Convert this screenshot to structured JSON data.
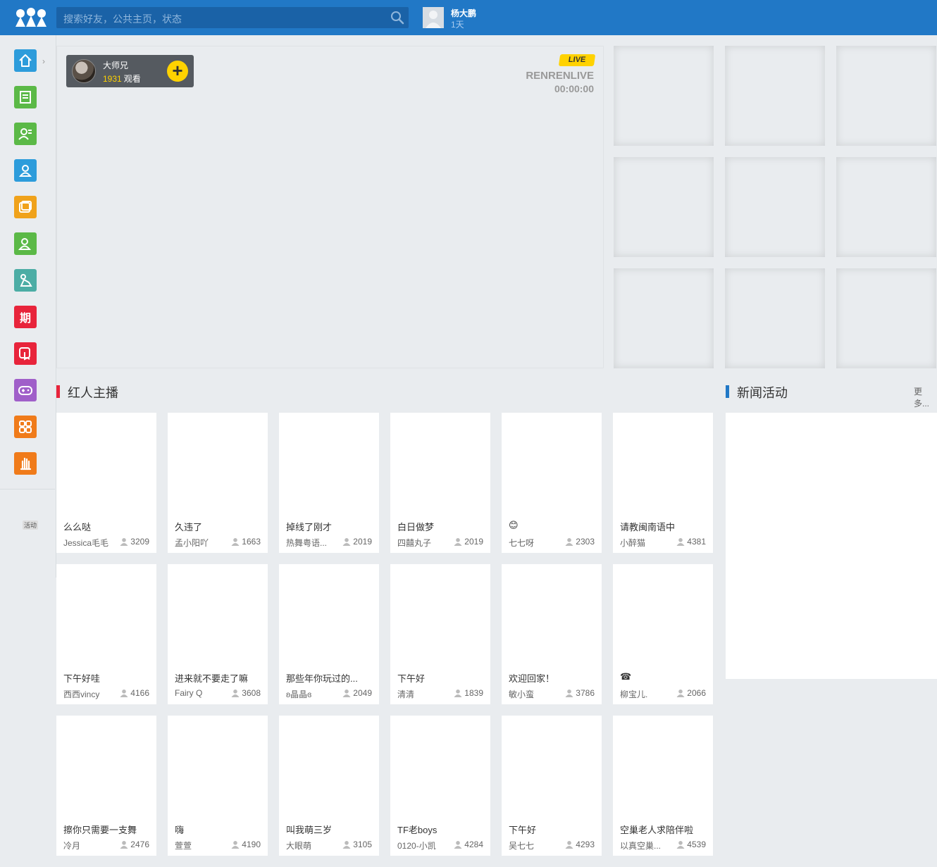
{
  "header": {
    "search_placeholder": "搜索好友，公共主页，状态",
    "user_name": "杨大鹏",
    "user_sub": "1天"
  },
  "sidebar": {
    "items": [
      {
        "icon": "home-icon",
        "color": "#2d9cdb"
      },
      {
        "icon": "notes-icon",
        "color": "#5bb947"
      },
      {
        "icon": "contacts-icon",
        "color": "#5bb947"
      },
      {
        "icon": "profile-icon",
        "color": "#2d9cdb"
      },
      {
        "icon": "photo-icon",
        "color": "#f0a21b"
      },
      {
        "icon": "friends-icon",
        "color": "#5bb947"
      },
      {
        "icon": "gift-icon",
        "color": "#4cada5"
      },
      {
        "icon": "issue-icon",
        "label": "期",
        "color": "#e8243b"
      },
      {
        "icon": "touch-icon",
        "color": "#e8243b"
      },
      {
        "icon": "gamepad-icon",
        "color": "#a05fc9"
      },
      {
        "icon": "apps-icon",
        "color": "#f07b1a"
      },
      {
        "icon": "hand-icon",
        "color": "#f07b1a"
      }
    ],
    "activity_label": "活动"
  },
  "live": {
    "host_name": "大师兄",
    "viewers": "1931",
    "viewers_suffix": "观看",
    "badge": "LIVE",
    "channel": "RENRENLIVE",
    "timer": "00:00:00"
  },
  "sections": {
    "stars_title": "红人主播",
    "stars_color": "#e8243b",
    "news_title": "新闻活动",
    "news_color": "#2178c6",
    "more": "更多..."
  },
  "cards": [
    {
      "title": "么么哒",
      "user": "Jessica毛毛",
      "count": "3209"
    },
    {
      "title": "久违了",
      "user": "孟小阳吖",
      "count": "1663"
    },
    {
      "title": "掉线了刚才",
      "user": "热舞粤语...",
      "count": "2019"
    },
    {
      "title": "白日做梦",
      "user": "四囍丸子",
      "count": "2019"
    },
    {
      "title": "😊",
      "user": "七七呀",
      "count": "2303"
    },
    {
      "title": "请教闽南语中",
      "user": "小醉猫",
      "count": "4381"
    },
    {
      "title": "下午好哇",
      "user": "西西vincy",
      "count": "4166"
    },
    {
      "title": "进来就不要走了嘛",
      "user": "Fairy Q",
      "count": "3608"
    },
    {
      "title": "那些年你玩过的...",
      "user": "ʚ晶晶ɞ",
      "count": "2049"
    },
    {
      "title": "下午好",
      "user": "清清",
      "count": "1839"
    },
    {
      "title": "欢迎回家！",
      "user": "敏小蛮",
      "count": "3786"
    },
    {
      "title": "☎",
      "user": "柳宝儿.",
      "count": "2066"
    },
    {
      "title": "擦你只需要一支舞",
      "user": "冷月",
      "count": "2476"
    },
    {
      "title": "嗨",
      "user": "萱萱",
      "count": "4190"
    },
    {
      "title": "叫我萌三岁",
      "user": "大眼萌",
      "count": "3105"
    },
    {
      "title": "TF老boys",
      "user": "0120-小凯",
      "count": "4284"
    },
    {
      "title": "下午好",
      "user": "吴七七",
      "count": "4293"
    },
    {
      "title": "空巢老人求陪伴啦",
      "user": "以真空巢...",
      "count": "4539"
    }
  ]
}
